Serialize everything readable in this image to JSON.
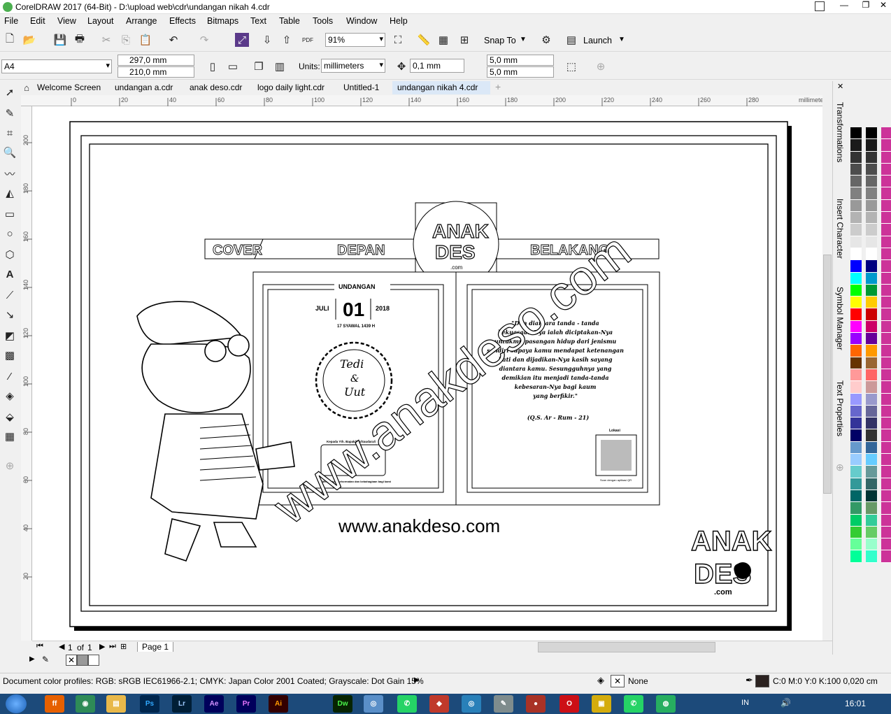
{
  "app": {
    "title": "CorelDRAW 2017 (64-Bit) - D:\\upload web\\cdr\\undangan nikah 4.cdr"
  },
  "menu": [
    "File",
    "Edit",
    "View",
    "Layout",
    "Arrange",
    "Effects",
    "Bitmaps",
    "Text",
    "Table",
    "Tools",
    "Window",
    "Help"
  ],
  "toolbar": {
    "zoom": "91%",
    "snap": "Snap To",
    "launch": "Launch"
  },
  "props": {
    "page_size": "A4",
    "width": "297,0 mm",
    "height": "210,0 mm",
    "units_label": "Units:",
    "units": "millimeters",
    "nudge": "0,1 mm",
    "dup_x": "5,0 mm",
    "dup_y": "5,0 mm"
  },
  "tabs": [
    "Welcome Screen",
    "undangan a.cdr",
    "anak deso.cdr",
    "logo daily light.cdr",
    "Untitled-1",
    "undangan nikah 4.cdr"
  ],
  "ruler": {
    "unit": "millimeters",
    "h_ticks": [
      "0",
      "20",
      "40",
      "60",
      "80",
      "100",
      "120",
      "140",
      "160",
      "180",
      "200",
      "220",
      "240",
      "260",
      "280"
    ],
    "v_ticks": [
      "200",
      "180",
      "160",
      "140",
      "120",
      "100",
      "80",
      "60",
      "40",
      "20"
    ]
  },
  "doc": {
    "cover": "COVER",
    "depan": "DEPAN",
    "belakang": "BELAKANG",
    "logo_top": "ANAK",
    "logo_bottom": "DES",
    "logo_com": ".com",
    "undangan": "UNDANGAN",
    "month": "JULI",
    "day": "01",
    "year": "2018",
    "hijri": "17 SYAWAL 1439 H",
    "names_1": "Tedi",
    "names_amp": "&",
    "names_2": "Uut",
    "to": "Kepada Yth. Bapak/Ibu/Saudara/i",
    "note": "Merupakan kehormatan dan kebahagiaan bagi kami",
    "verse": [
      "\"Dan diantara tanda - tanda",
      "kekuasaan-Nya ialah diciptakan-Nya",
      "untukmu pasangan hidup dari jenismu",
      "sendiri supaya kamu mendapat ketenangan",
      "hati dan dijadikan-Nya kasih sayang",
      "diantara kamu. Sesungguhnya yang",
      "demikian itu menjadi tanda-tanda",
      "kebesaran-Nya bagi kaum",
      "yang berfikir.\""
    ],
    "verse_ref": "(Q.S. Ar - Rum - 21)",
    "qr_label": "Lokasi",
    "qr_sub": "Scan dengan aplikasi QR",
    "watermark": "www.anakdeso.com",
    "website": "www.anakdeso.com"
  },
  "pager": {
    "current": "1",
    "of": "of",
    "total": "1",
    "page": "Page 1"
  },
  "docker": [
    "Transformations",
    "Insert Character",
    "Symbol Manager",
    "Text Properties"
  ],
  "status": {
    "profiles": "Document color profiles: RGB: sRGB IEC61966-2.1; CMYK: Japan Color 2001 Coated; Grayscale: Dot Gain 15%",
    "fill": "None",
    "outline": "C:0 M:0 Y:0 K:100  0,020 cm"
  },
  "taskbar": {
    "time": "16:01",
    "lang": "IN"
  },
  "palette_colors": [
    "#000000",
    "#1a1a1a",
    "#333333",
    "#4d4d4d",
    "#666666",
    "#808080",
    "#999999",
    "#b3b3b3",
    "#cccccc",
    "#e6e6e6",
    "#ffffff",
    "#0000ff",
    "#00ffff",
    "#00ff00",
    "#ffff00",
    "#ff0000",
    "#ff00ff",
    "#9900ff",
    "#ff6600",
    "#663300",
    "#ff9999",
    "#ffcccc",
    "#9999ff",
    "#6666cc",
    "#333399",
    "#000066",
    "#6699cc",
    "#99ccff",
    "#66cccc",
    "#339999",
    "#006666",
    "#339966",
    "#00cc66",
    "#33cc33",
    "#66ff99",
    "#00ff99"
  ],
  "palette2": [
    "#000000",
    "#1a1a1a",
    "#333333",
    "#4d4d4d",
    "#666666",
    "#808080",
    "#999999",
    "#b3b3b3",
    "#cccccc",
    "#e6e6e6",
    "#ffffff",
    "#000080",
    "#0099cc",
    "#009933",
    "#ffcc00",
    "#cc0000",
    "#cc0066",
    "#660099",
    "#ff9900",
    "#996633",
    "#ff6666",
    "#cc9999",
    "#9999cc",
    "#666699",
    "#333366",
    "#333333",
    "#336699",
    "#66ccff",
    "#669999",
    "#336666",
    "#003333",
    "#669966",
    "#33cc99",
    "#66cc66",
    "#99ffcc",
    "#33ffcc"
  ],
  "palette3": [
    "#cc3399",
    "#cc3399",
    "#cc3399",
    "#cc3399",
    "#cc3399",
    "#cc3399",
    "#cc3399",
    "#cc3399",
    "#cc3399",
    "#cc3399",
    "#cc3399",
    "#cc3399",
    "#cc3399",
    "#cc3399",
    "#cc3399",
    "#cc3399",
    "#cc3399",
    "#cc3399",
    "#cc3399",
    "#cc3399",
    "#cc3399",
    "#cc3399",
    "#cc3399",
    "#cc3399",
    "#cc3399",
    "#cc3399",
    "#cc3399",
    "#cc3399",
    "#cc3399",
    "#cc3399",
    "#cc3399",
    "#cc3399",
    "#cc3399",
    "#cc3399",
    "#cc3399",
    "#cc3399"
  ]
}
